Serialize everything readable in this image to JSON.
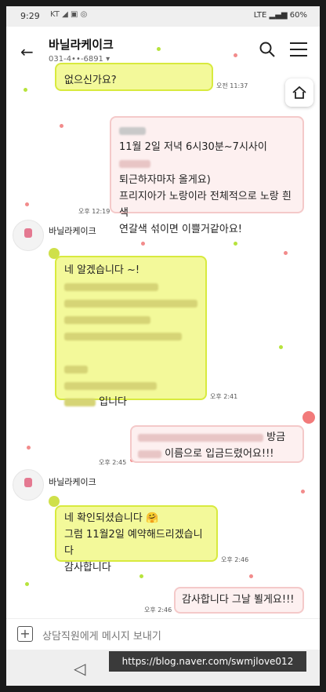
{
  "status_bar": {
    "time": "9:29",
    "carrier": "KT",
    "battery": "60%",
    "network": "LTE"
  },
  "header": {
    "title": "바닐라케이크",
    "phone": "031-4••-6891 ▾"
  },
  "messages": [
    {
      "id": "m0",
      "text": "없으신가요?",
      "time": "오전 11:37"
    },
    {
      "id": "m1",
      "line1_visible": "11월 2일 저녁 6시30분~7시사이",
      "line2": "퇴근하자마자 올게요)",
      "line3": "프리지아가 노랑이라 전체적으로 노랑 흰색",
      "line4": "연갈색 섞이면 이쁠거같아요!",
      "time": "오후 12:19"
    },
    {
      "id": "m2",
      "sender": "바닐라케이크",
      "line1": "네 알겠습니다 ~!",
      "last": "입니다",
      "time": "오후 2:41"
    },
    {
      "id": "m3",
      "tail1": "방금",
      "line2": "이름으로 입금드렸어요!!!",
      "time": "오후 2:45"
    },
    {
      "id": "m4",
      "sender": "바닐라케이크",
      "line1": "네 확인되셨습니다 🤗",
      "line2": "그럼 11월2일 예약해드리겠습니다",
      "line3": "감사합니다",
      "time": "오후 2:46"
    },
    {
      "id": "m5",
      "text": "감사합니다 그날 뵐게요!!!",
      "time": "오후 2:46"
    }
  ],
  "input": {
    "placeholder": "상담직원에게 메시지 보내기"
  },
  "watermark": "https://blog.naver.com/swmjlove012"
}
